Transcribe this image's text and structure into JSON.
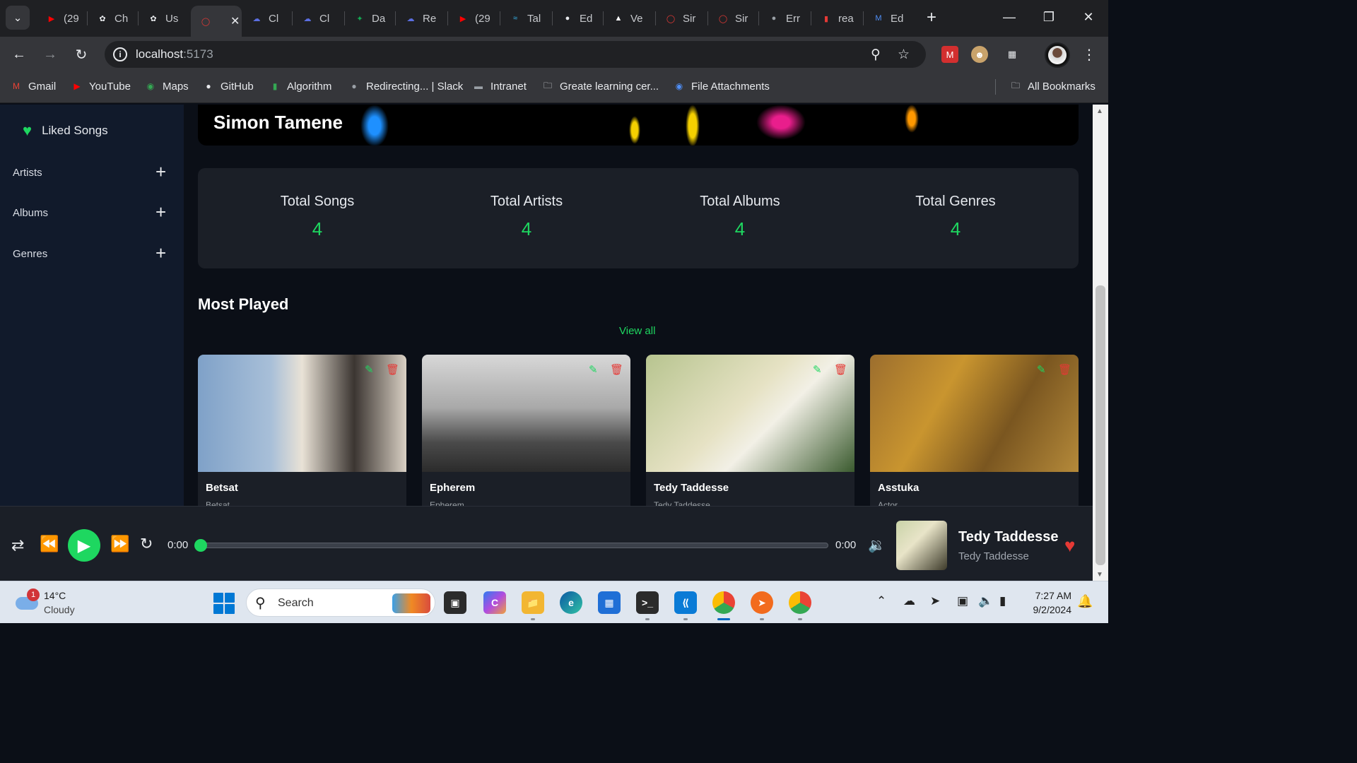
{
  "browser": {
    "tabs": [
      {
        "title": "(29",
        "icon": "youtube-icon",
        "color": "#ff0000"
      },
      {
        "title": "Ch",
        "icon": "openai-icon",
        "color": "#e8eaed"
      },
      {
        "title": "Us",
        "icon": "openai-icon",
        "color": "#e8eaed"
      },
      {
        "title": "",
        "icon": "app-logo-icon",
        "color": "#e53935",
        "active": true
      },
      {
        "title": "Cl",
        "icon": "cloud-icon",
        "color": "#5b6ee1"
      },
      {
        "title": "Cl",
        "icon": "cloud-icon",
        "color": "#5b6ee1"
      },
      {
        "title": "Da",
        "icon": "mongodb-icon",
        "color": "#13aa52"
      },
      {
        "title": "Re",
        "icon": "cloud-icon",
        "color": "#5b6ee1"
      },
      {
        "title": "(29",
        "icon": "youtube-icon",
        "color": "#ff0000"
      },
      {
        "title": "Tal",
        "icon": "tailwind-icon",
        "color": "#38bdf8"
      },
      {
        "title": "Ed",
        "icon": "github-icon",
        "color": "#e8eaed"
      },
      {
        "title": "Ve",
        "icon": "vercel-icon",
        "color": "#ffffff"
      },
      {
        "title": "Sir",
        "icon": "app-logo-icon",
        "color": "#e53935"
      },
      {
        "title": "Sir",
        "icon": "app-logo-icon",
        "color": "#e53935"
      },
      {
        "title": "Err",
        "icon": "globe-icon",
        "color": "#9aa0a6"
      },
      {
        "title": "rea",
        "icon": "bookmark-red-icon",
        "color": "#e53935"
      },
      {
        "title": "Ed",
        "icon": "medium-icon",
        "color": "#4f8ff7"
      }
    ],
    "url_host": "localhost",
    "url_port": ":5173",
    "bookmarks": [
      {
        "label": "Gmail",
        "icon": "gmail-icon",
        "color": "#ea4335"
      },
      {
        "label": "YouTube",
        "icon": "youtube-icon",
        "color": "#ff0000"
      },
      {
        "label": "Maps",
        "icon": "maps-icon",
        "color": "#34a853"
      },
      {
        "label": "GitHub",
        "icon": "github-icon",
        "color": "#e8eaed"
      },
      {
        "label": "Algorithm",
        "icon": "algorithm-icon",
        "color": "#34a853"
      },
      {
        "label": "Redirecting... | Slack",
        "icon": "globe-icon",
        "color": "#9aa0a6"
      },
      {
        "label": "Intranet",
        "icon": "intranet-icon",
        "color": "#9aa0a6"
      },
      {
        "label": "Greate learning cer...",
        "icon": "folder-icon",
        "color": "#e8eaed"
      },
      {
        "label": "File Attachments",
        "icon": "attachments-icon",
        "color": "#4f8ff7"
      }
    ],
    "all_bookmarks": "All Bookmarks"
  },
  "sidebar": {
    "liked_songs": "Liked Songs",
    "sections": [
      {
        "label": "Artists"
      },
      {
        "label": "Albums"
      },
      {
        "label": "Genres"
      }
    ]
  },
  "banner": {
    "name": "Simon Tamene"
  },
  "stats": [
    {
      "label": "Total Songs",
      "value": "4"
    },
    {
      "label": "Total Artists",
      "value": "4"
    },
    {
      "label": "Total Albums",
      "value": "4"
    },
    {
      "label": "Total Genres",
      "value": "4"
    }
  ],
  "most_played": {
    "title": "Most Played",
    "view_all": "View all",
    "songs": [
      {
        "title": "Betsat",
        "subtitle": "Betsat"
      },
      {
        "title": "Epherem",
        "subtitle": "Epherem"
      },
      {
        "title": "Tedy Taddesse",
        "subtitle": "Tedy Taddesse"
      },
      {
        "title": "Asstuka",
        "subtitle": "Actor"
      }
    ]
  },
  "player": {
    "current_time": "0:00",
    "duration": "0:00",
    "progress": 0,
    "now_playing_title": "Tedy Taddesse",
    "now_playing_artist": "Tedy Taddesse",
    "accent": "#1ed760"
  },
  "taskbar": {
    "weather_temp": "14°C",
    "weather_cond": "Cloudy",
    "weather_badge": "1",
    "search_placeholder": "Search",
    "time": "7:27 AM",
    "date": "9/2/2024"
  }
}
